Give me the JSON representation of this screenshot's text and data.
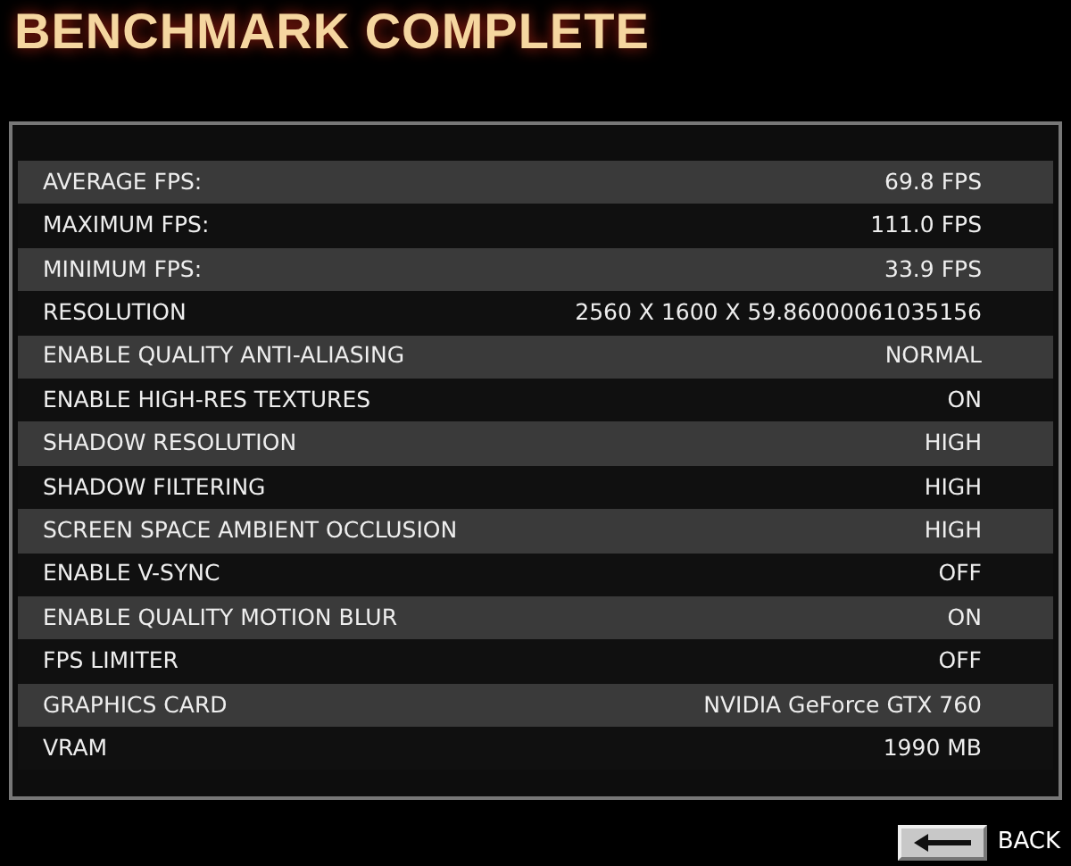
{
  "title": "BENCHMARK COMPLETE",
  "rows": [
    {
      "label": "AVERAGE FPS:",
      "value": "69.8 FPS"
    },
    {
      "label": "MAXIMUM FPS:",
      "value": "111.0 FPS"
    },
    {
      "label": "MINIMUM FPS:",
      "value": "33.9 FPS"
    },
    {
      "label": "RESOLUTION",
      "value": "2560 X 1600 X 59.86000061035156"
    },
    {
      "label": "ENABLE QUALITY ANTI-ALIASING",
      "value": "NORMAL"
    },
    {
      "label": "ENABLE HIGH-RES TEXTURES",
      "value": "ON"
    },
    {
      "label": "SHADOW RESOLUTION",
      "value": "HIGH"
    },
    {
      "label": "SHADOW FILTERING",
      "value": "HIGH"
    },
    {
      "label": "SCREEN SPACE AMBIENT OCCLUSION",
      "value": "HIGH"
    },
    {
      "label": "ENABLE V-SYNC",
      "value": "OFF"
    },
    {
      "label": "ENABLE QUALITY MOTION BLUR",
      "value": "ON"
    },
    {
      "label": "FPS LIMITER",
      "value": "OFF"
    },
    {
      "label": "GRAPHICS CARD",
      "value": "NVIDIA GeForce GTX 760"
    },
    {
      "label": "VRAM",
      "value": "1990 MB"
    }
  ],
  "back": {
    "label": "BACK"
  }
}
